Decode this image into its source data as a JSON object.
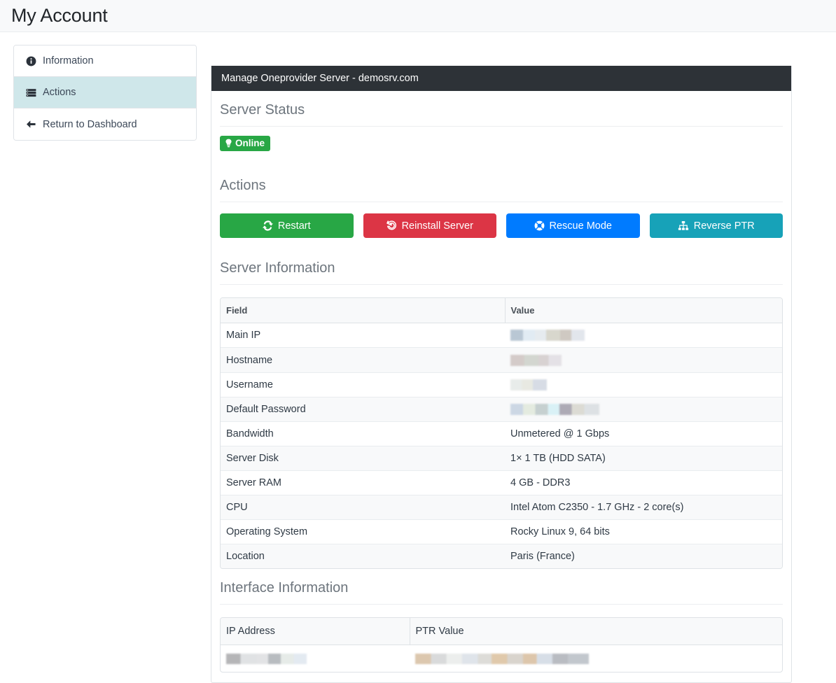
{
  "topbar": {
    "title": "My Account"
  },
  "sidebar": {
    "items": [
      {
        "label": "Information",
        "icon": "info-circle-icon",
        "active": false
      },
      {
        "label": "Actions",
        "icon": "server-stack-icon",
        "active": true
      },
      {
        "label": "Return to Dashboard",
        "icon": "arrow-left-icon",
        "active": false
      }
    ]
  },
  "panel": {
    "header": "Manage Oneprovider Server - demosrv.com",
    "sections": {
      "server_status": {
        "title": "Server Status",
        "badge": {
          "label": "Online",
          "color": "#28a745",
          "icon": "lightbulb-icon"
        }
      },
      "actions": {
        "title": "Actions",
        "buttons": [
          {
            "label": "Restart",
            "icon": "sync-icon",
            "color": "#28a745"
          },
          {
            "label": "Reinstall Server",
            "icon": "undo-icon",
            "color": "#dc3545"
          },
          {
            "label": "Rescue Mode",
            "icon": "life-ring-icon",
            "color": "#007bff"
          },
          {
            "label": "Reverse PTR",
            "icon": "sitemap-icon",
            "color": "#17a2b8"
          }
        ]
      },
      "server_information": {
        "title": "Server Information",
        "columns": [
          "Field",
          "Value"
        ],
        "rows": [
          {
            "field": "Main IP",
            "value": "",
            "redacted": true
          },
          {
            "field": "Hostname",
            "value": "",
            "redacted": true
          },
          {
            "field": "Username",
            "value": "",
            "redacted": true
          },
          {
            "field": "Default Password",
            "value": "",
            "redacted": true
          },
          {
            "field": "Bandwidth",
            "value": "Unmetered @ 1 Gbps",
            "redacted": false
          },
          {
            "field": "Server Disk",
            "value": "1× 1 TB (HDD SATA)",
            "redacted": false
          },
          {
            "field": "Server RAM",
            "value": "4 GB - DDR3",
            "redacted": false
          },
          {
            "field": "CPU",
            "value": "Intel Atom C2350 - 1.7 GHz - 2 core(s)",
            "redacted": false
          },
          {
            "field": "Operating System",
            "value": "Rocky Linux 9, 64 bits",
            "redacted": false
          },
          {
            "field": "Location",
            "value": "Paris (France)",
            "redacted": false
          }
        ]
      },
      "interface_information": {
        "title": "Interface Information",
        "columns": [
          "IP Address",
          "PTR Value"
        ],
        "rows": [
          {
            "ip_address": "",
            "ptr_value": "",
            "redacted": true
          }
        ]
      }
    }
  }
}
